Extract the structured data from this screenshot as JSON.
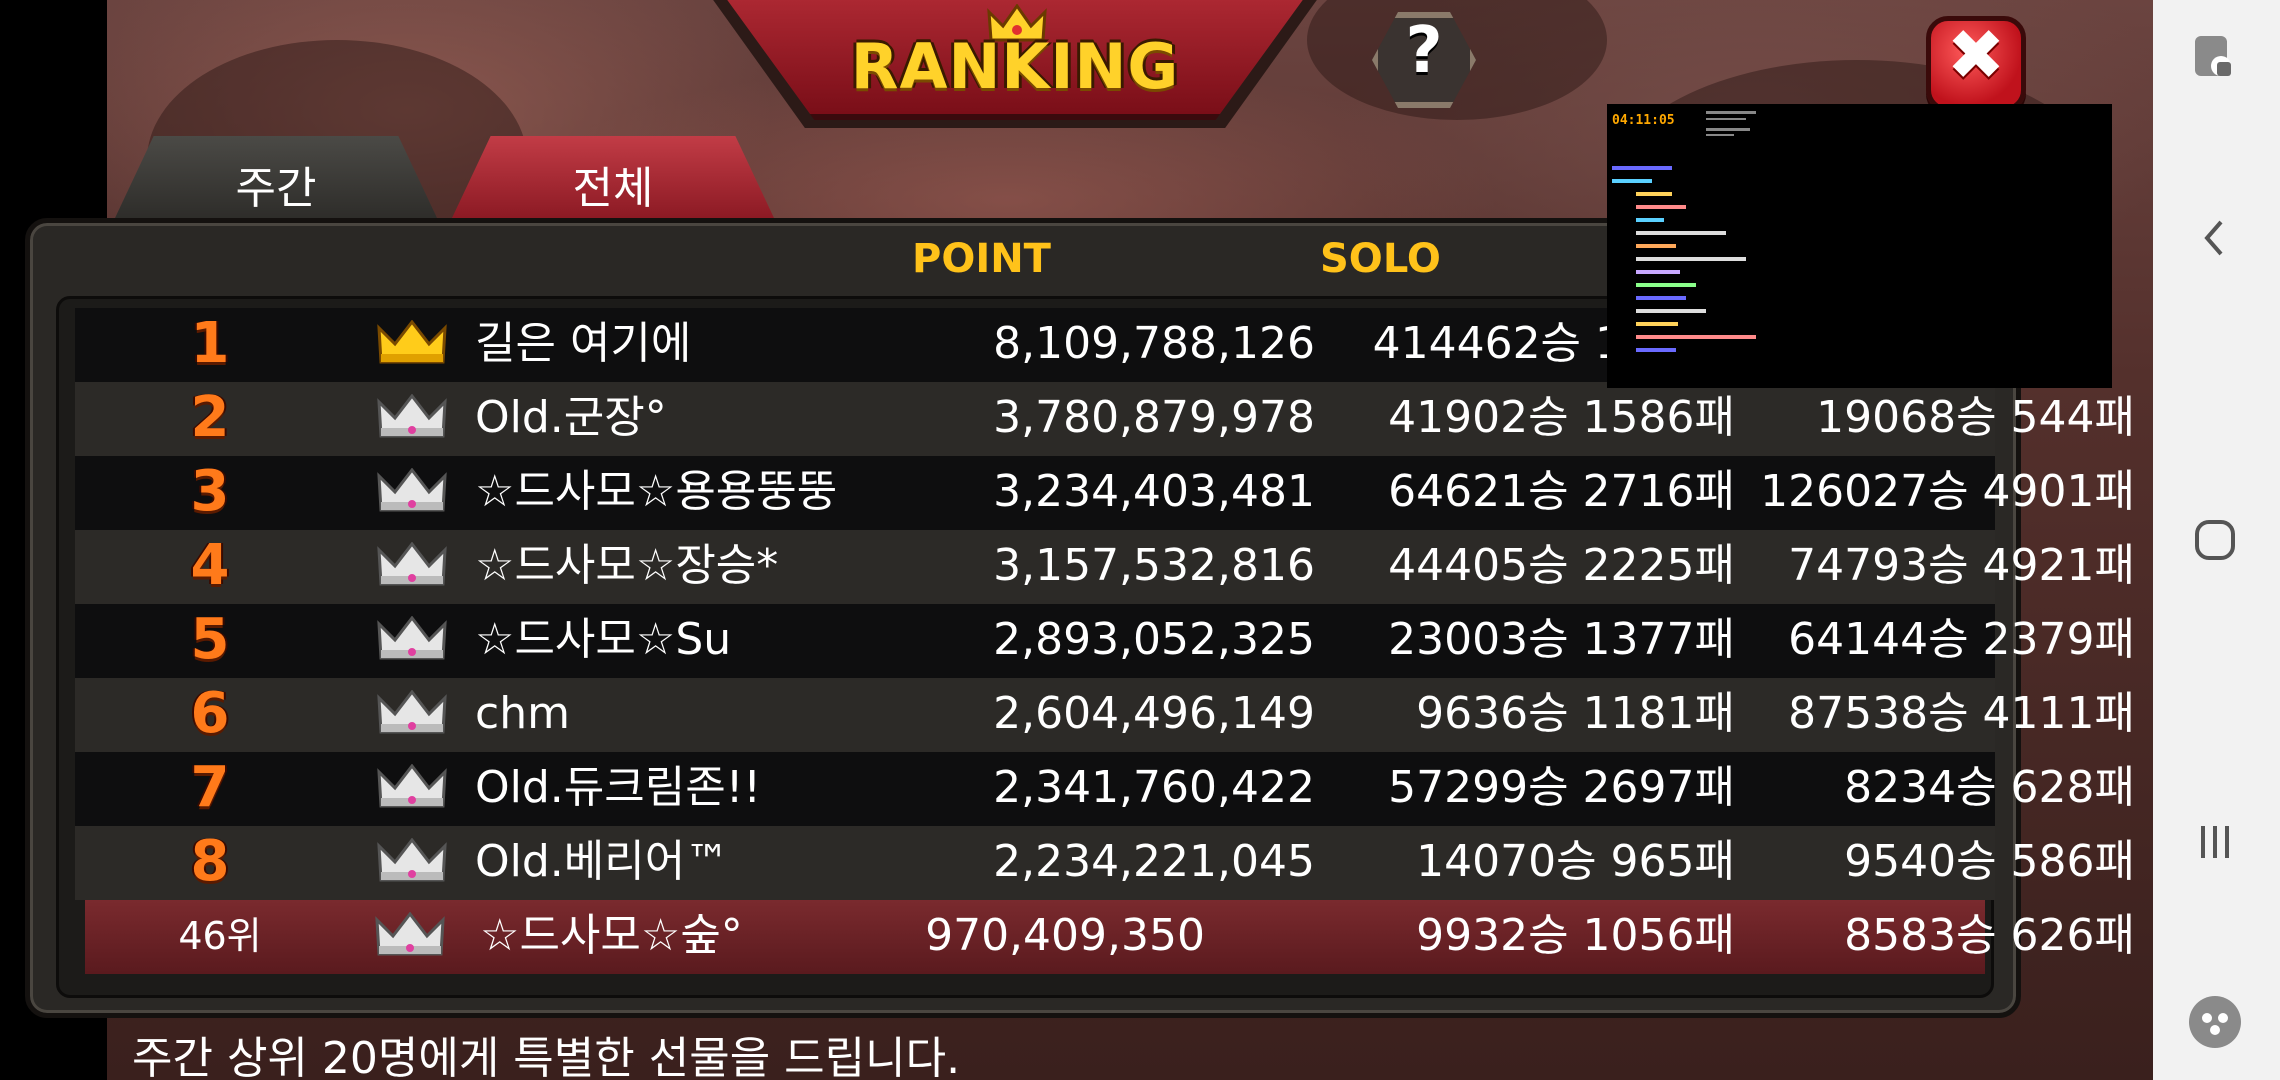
{
  "title": "RANKING",
  "tabs": [
    {
      "label": "주간",
      "active": true
    },
    {
      "label": "전체",
      "active": false
    }
  ],
  "columns": {
    "point": "POINT",
    "solo": "SOLO"
  },
  "rows": [
    {
      "rank": "1",
      "crown": "gold",
      "name": "길은 여기에",
      "point": "8,109,788,126",
      "solo": "414462승 12328",
      "team": ""
    },
    {
      "rank": "2",
      "crown": "silver",
      "name": "Old.군장°",
      "point": "3,780,879,978",
      "solo": "41902승 1586패",
      "team": "19068승 544패"
    },
    {
      "rank": "3",
      "crown": "silver",
      "name": "☆드사모☆용용뚱뚱",
      "point": "3,234,403,481",
      "solo": "64621승 2716패",
      "team": "126027승 4901패"
    },
    {
      "rank": "4",
      "crown": "silver",
      "name": "☆드사모☆장승*",
      "point": "3,157,532,816",
      "solo": "44405승 2225패",
      "team": "74793승 4921패"
    },
    {
      "rank": "5",
      "crown": "silver",
      "name": "☆드사모☆Su",
      "point": "2,893,052,325",
      "solo": "23003승 1377패",
      "team": "64144승 2379패"
    },
    {
      "rank": "6",
      "crown": "silver",
      "name": "chm",
      "point": "2,604,496,149",
      "solo": "9636승 1181패",
      "team": "87538승 4111패"
    },
    {
      "rank": "7",
      "crown": "silver",
      "name": "Old.듀크림존!!",
      "point": "2,341,760,422",
      "solo": "57299승 2697패",
      "team": "8234승 628패"
    },
    {
      "rank": "8",
      "crown": "silver",
      "name": "Old.베리어™",
      "point": "2,234,221,045",
      "solo": "14070승 965패",
      "team": "9540승 586패"
    }
  ],
  "my_row": {
    "rank": "46위",
    "crown": "silver",
    "name": "☆드사모☆숲°",
    "point": "970,409,350",
    "solo": "9932승 1056패",
    "team": "8583승 626패"
  },
  "footer": "주간 상위 20명에게 특별한 선물을 드립니다.",
  "recording": {
    "time": "04:11:05"
  },
  "colors": {
    "accent": "#ffc21a",
    "rank_number": "#ff7a1a",
    "tab_active": "#4b4a46",
    "tab_inactive": "#c23c46",
    "my_row": "#7a2a2e"
  },
  "icons": {
    "help": "help-icon",
    "close": "close-icon",
    "crown": "crown-icon"
  },
  "navbar_icons": [
    "touch-lock-icon",
    "back-icon",
    "home-icon",
    "recents-icon",
    "game-tools-icon"
  ]
}
